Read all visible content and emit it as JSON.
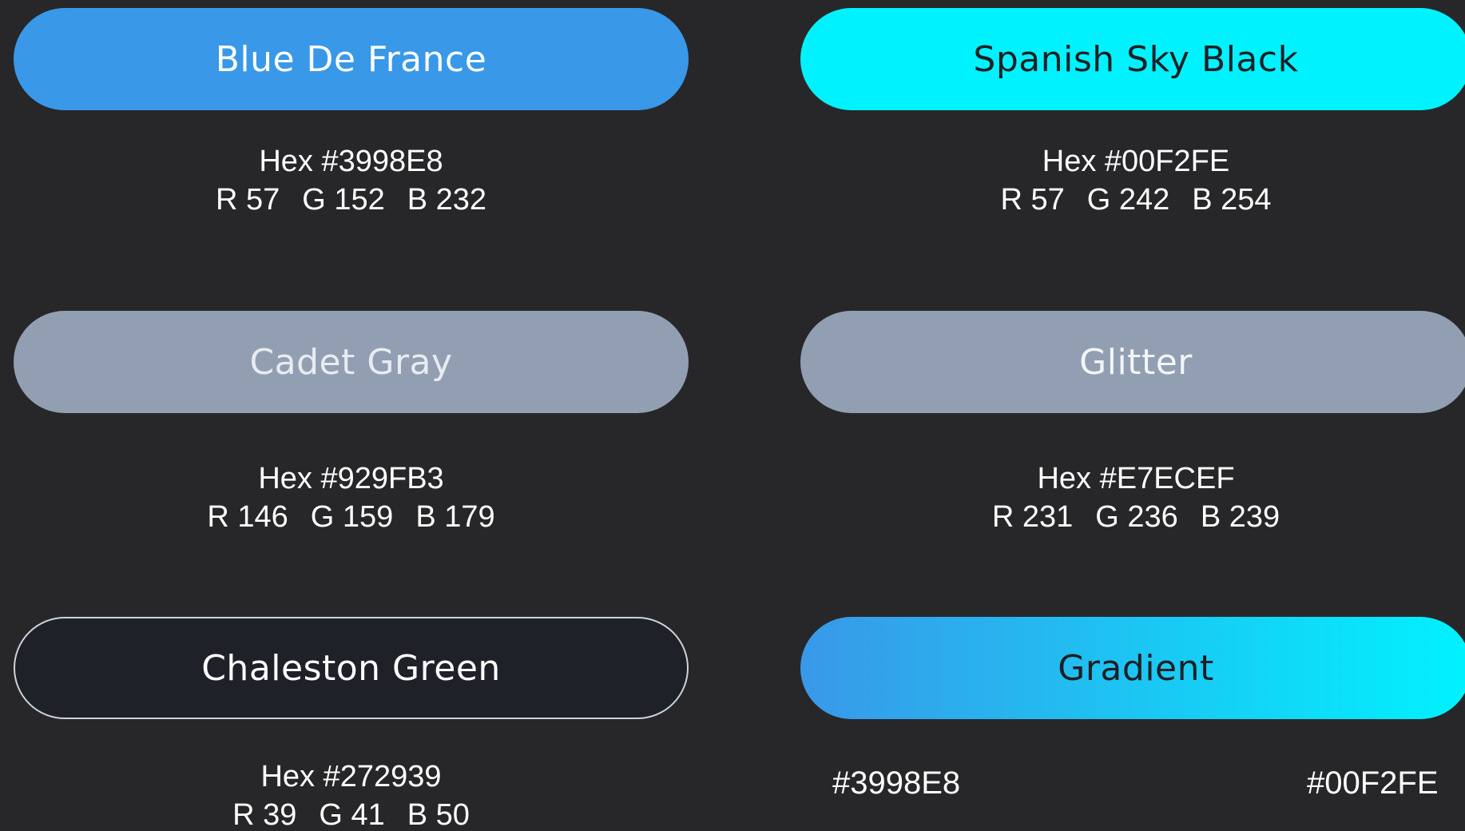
{
  "swatches": [
    {
      "name": "Blue De France",
      "hex": "Hex #3998E8",
      "r": "R 57",
      "g": "G 152",
      "b": "B 232"
    },
    {
      "name": "Spanish Sky Black",
      "hex": "Hex #00F2FE",
      "r": "R 57",
      "g": "G 242",
      "b": "B 254"
    },
    {
      "name": "Cadet Gray",
      "hex": "Hex #929FB3",
      "r": "R 146",
      "g": "G 159",
      "b": "B 179"
    },
    {
      "name": "Glitter",
      "hex": "Hex #E7ECEF",
      "r": "R 231",
      "g": "G 236",
      "b": "B 239"
    },
    {
      "name": "Chaleston Green",
      "hex": "Hex #272939",
      "r": "R 39",
      "g": "G 41",
      "b": "B 50"
    }
  ],
  "gradient": {
    "name": "Gradient",
    "start": "#3998E8",
    "end": "#00F2FE"
  },
  "colors": {
    "background": "#272729",
    "blue_de_france": "#3998E8",
    "spanish_sky": "#00F2FE",
    "cadet_gray": "#929FB3",
    "chaleston_green": "#1f2128"
  }
}
